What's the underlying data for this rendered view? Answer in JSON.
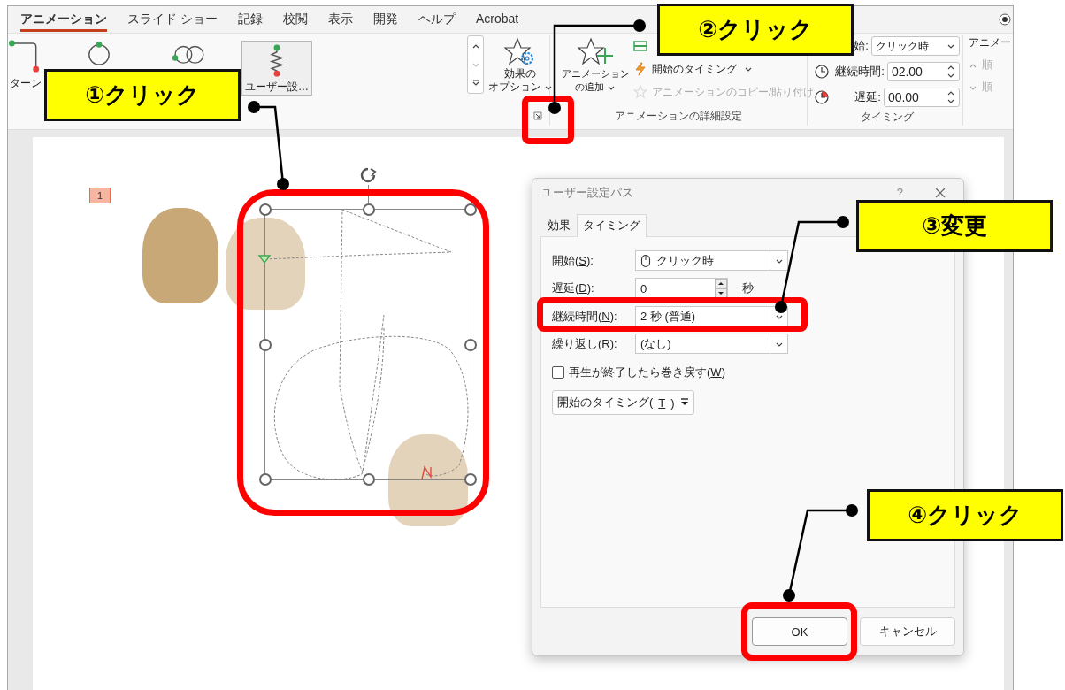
{
  "ribbon_tabs": [
    {
      "label": "アニメーション",
      "selected": true
    },
    {
      "label": "スライド ショー",
      "selected": false
    },
    {
      "label": "記録",
      "selected": false
    },
    {
      "label": "校閲",
      "selected": false
    },
    {
      "label": "表示",
      "selected": false
    },
    {
      "label": "開発",
      "selected": false
    },
    {
      "label": "ヘルプ",
      "selected": false
    },
    {
      "label": "Acrobat",
      "selected": false
    }
  ],
  "gallery": {
    "items": [
      {
        "kind": "turn",
        "label": "ターン",
        "selected": false
      },
      {
        "kind": "circle",
        "selected": false
      },
      {
        "kind": "loops",
        "selected": false
      },
      {
        "kind": "custom",
        "label": "ユーザー設…",
        "selected": true
      }
    ]
  },
  "effect_options": {
    "label_lines": [
      "効果の",
      "オプション"
    ]
  },
  "advanced": {
    "add_animation_lines": [
      "アニメーション",
      "の追加"
    ],
    "items": [
      {
        "kind": "pane",
        "disabled": false
      },
      {
        "kind": "trigger",
        "label": "開始のタイミング",
        "disabled": false
      },
      {
        "kind": "painter",
        "label": "アニメーションのコピー/貼り付け",
        "disabled": true
      }
    ],
    "group_label": "アニメーションの詳細設定"
  },
  "timing": {
    "start_label": "始:",
    "start_value": "クリック時",
    "duration_label": "継続時間:",
    "duration_value": "02.00",
    "delay_label": "遅延:",
    "delay_value": "00.00",
    "group_label": "タイミング"
  },
  "reorder": {
    "title": "アニメー",
    "items": [
      {
        "label": "順",
        "disabled": true
      },
      {
        "label": "順",
        "disabled": true
      }
    ]
  },
  "slide": {
    "animation_number": "1"
  },
  "dialog": {
    "title": "ユーザー設定パス",
    "help": "?",
    "tabs": [
      {
        "label": "効果",
        "selected": false
      },
      {
        "label": "タイミング",
        "selected": true
      }
    ],
    "fields": [
      {
        "kind": "trigger_dropdown",
        "label": {
          "before": "開始(",
          "key": "S",
          "after": "):"
        },
        "value": "クリック時"
      },
      {
        "kind": "spinner",
        "label": {
          "before": "遅延(",
          "key": "D",
          "after": "):"
        },
        "value": "0",
        "unit": "秒"
      },
      {
        "kind": "dropdown",
        "label": {
          "before": "継続時間(",
          "key": "N",
          "after": "):"
        },
        "value": "2 秒 (普通)"
      },
      {
        "kind": "dropdown",
        "label": {
          "before": "繰り返し(",
          "key": "R",
          "after": "):"
        },
        "value": "(なし)"
      }
    ],
    "checkbox": {
      "label": {
        "before": "再生が終了したら巻き戻す(",
        "key": "W",
        "after": ")"
      },
      "checked": false
    },
    "trigger_button": {
      "label": {
        "before": "開始のタイミング(",
        "key": "T",
        "after": ")"
      }
    },
    "buttons": [
      {
        "label": "OK",
        "kind": "default"
      },
      {
        "label": "キャンセル",
        "kind": "cancel"
      }
    ]
  },
  "callouts": [
    {
      "text": "①クリック"
    },
    {
      "text": "②クリック"
    },
    {
      "text": "③変更"
    },
    {
      "text": "④クリック"
    }
  ]
}
